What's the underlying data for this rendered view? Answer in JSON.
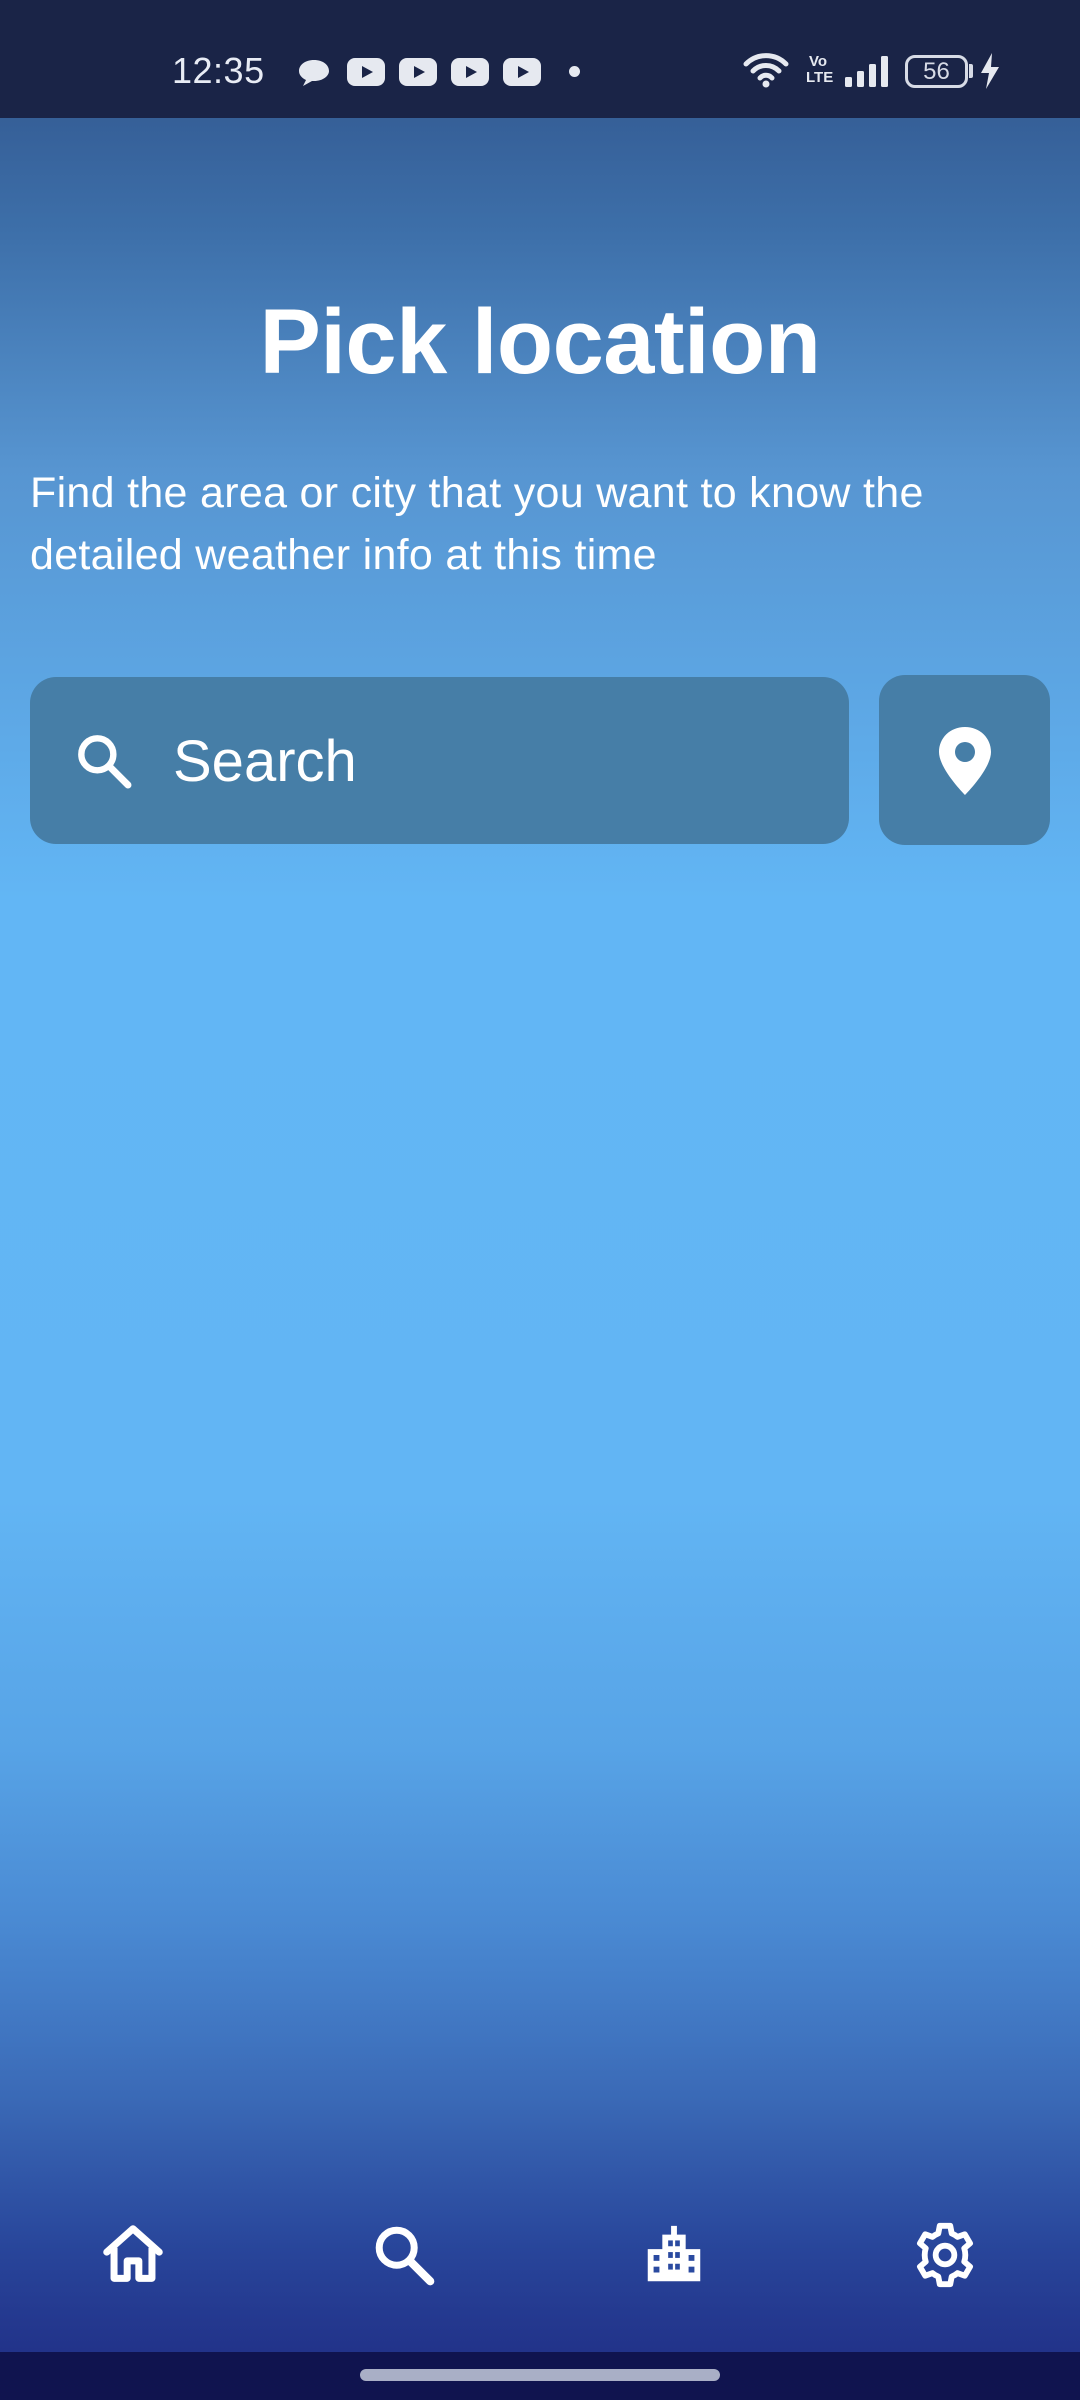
{
  "status_bar": {
    "time": "12:35",
    "battery_level": "56",
    "network_label": "Vo LTE",
    "notification_icons": [
      "chat-bubble-icon",
      "youtube-icon",
      "youtube-icon",
      "youtube-icon",
      "youtube-icon",
      "more-dot-icon"
    ],
    "system_icons": [
      "wifi-icon",
      "volte-icon",
      "signal-icon",
      "battery-icon",
      "charging-icon"
    ]
  },
  "main": {
    "title": "Pick location",
    "subtitle": "Find the area or city that you want to know the detailed weather info at this time",
    "search": {
      "placeholder": "Search",
      "value": "",
      "icon": "search-icon"
    },
    "location_button_icon": "location-pin-icon"
  },
  "bottom_nav": {
    "items": [
      {
        "icon": "home-icon"
      },
      {
        "icon": "search-icon"
      },
      {
        "icon": "city-icon"
      },
      {
        "icon": "settings-icon"
      }
    ]
  },
  "colors": {
    "status_bar_bg": "#1a2447",
    "search_field_bg": "#467ea7",
    "sky_blue": "#62b6f5",
    "bottom_gradient": "#22338a"
  }
}
